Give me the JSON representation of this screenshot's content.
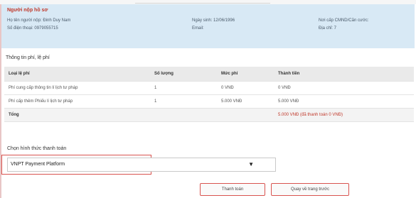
{
  "submitter": {
    "heading": "Người nộp hồ sơ",
    "full_name_label": "Họ tên người nộp: Đinh Duy Nam",
    "phone_label": "Số điện thoại: 0979055715",
    "birth_date_label": "Ngày sinh: 12/06/1996",
    "email_label": "Email:",
    "id_issue_place_label": "Nơi cấp CMND/Căn cước:",
    "address_label": "Địa chỉ: 7"
  },
  "fees": {
    "section_title": "Thông tin phí, lệ phí",
    "columns": [
      "Loại lệ phí",
      "Số lượng",
      "Mức phí",
      "Thành tiền"
    ],
    "rows": [
      [
        "Phí cung cấp thông tin lí lịch tư pháp",
        "1",
        "0 VNĐ",
        "0 VNĐ"
      ],
      [
        "Phí cấp thêm Phiếu lí lịch tư pháp",
        "1",
        "5.000 VNĐ",
        "5.000 VNĐ"
      ]
    ],
    "total_label": "Tổng",
    "total_value": "5.000 VNĐ (đã thanh toán 0 VNĐ)"
  },
  "payment": {
    "method_label": "Chọn hình thức thanh toán",
    "selected_method": "VNPT Payment Platform",
    "pay_button": "Thanh toán",
    "back_button": "Quay về trang trước"
  }
}
